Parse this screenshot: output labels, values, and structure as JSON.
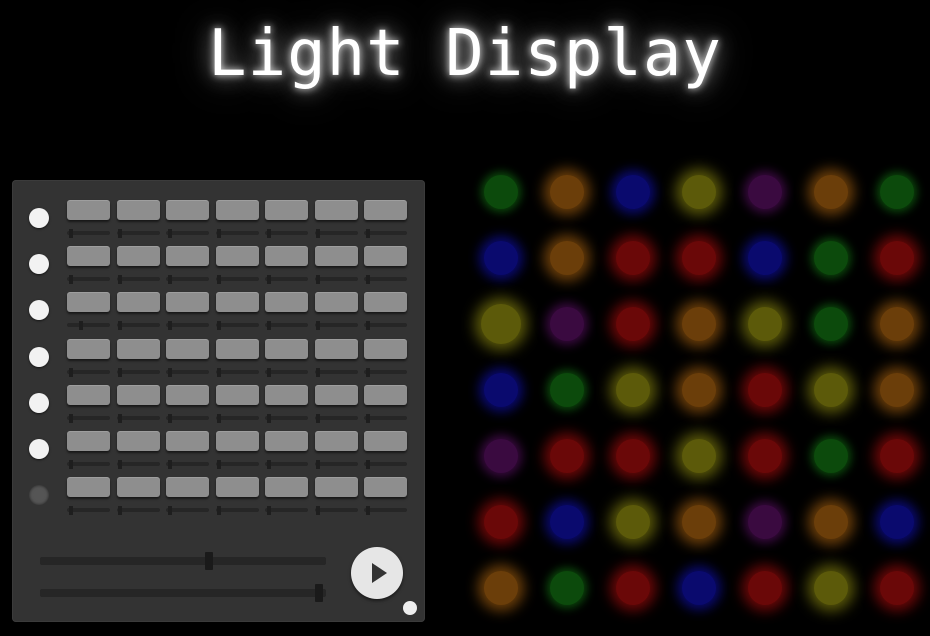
{
  "title": "Light Display",
  "panel": {
    "row_toggles": [
      true,
      true,
      true,
      true,
      true,
      true,
      false
    ],
    "steps_per_row": 7,
    "row_slider_levels": [
      [
        0.05,
        0.05,
        0.05,
        0.05,
        0.05,
        0.05,
        0.05
      ],
      [
        0.05,
        0.05,
        0.05,
        0.05,
        0.05,
        0.05,
        0.05
      ],
      [
        0.3,
        0.05,
        0.05,
        0.05,
        0.05,
        0.05,
        0.05
      ],
      [
        0.05,
        0.05,
        0.05,
        0.05,
        0.05,
        0.05,
        0.05
      ],
      [
        0.05,
        0.05,
        0.05,
        0.05,
        0.05,
        0.05,
        0.05
      ],
      [
        0.05,
        0.05,
        0.05,
        0.05,
        0.05,
        0.05,
        0.05
      ],
      [
        0.05,
        0.05,
        0.05,
        0.05,
        0.05,
        0.05,
        0.05
      ]
    ],
    "slider_1_level": 0.6,
    "slider_2_level": 0.99
  },
  "led_colors": {
    "green": "#0c4a0c",
    "orange": "#6b3e0a",
    "blue": "#0a0a6e",
    "yellow": "#5c5a0a",
    "purple": "#3a0a40",
    "red": "#6a0808"
  },
  "led_grid": [
    [
      "green",
      "orange",
      "blue",
      "yellow",
      "purple",
      "orange",
      "green"
    ],
    [
      "blue",
      "orange",
      "red",
      "red",
      "blue",
      "green",
      "red"
    ],
    [
      "yellow",
      "purple",
      "red",
      "orange",
      "yellow",
      "green",
      "orange"
    ],
    [
      "blue",
      "green",
      "yellow",
      "orange",
      "red",
      "yellow",
      "orange"
    ],
    [
      "purple",
      "red",
      "red",
      "yellow",
      "red",
      "green",
      "red"
    ],
    [
      "red",
      "blue",
      "yellow",
      "orange",
      "purple",
      "orange",
      "blue"
    ],
    [
      "orange",
      "green",
      "red",
      "blue",
      "red",
      "yellow",
      "red"
    ]
  ]
}
